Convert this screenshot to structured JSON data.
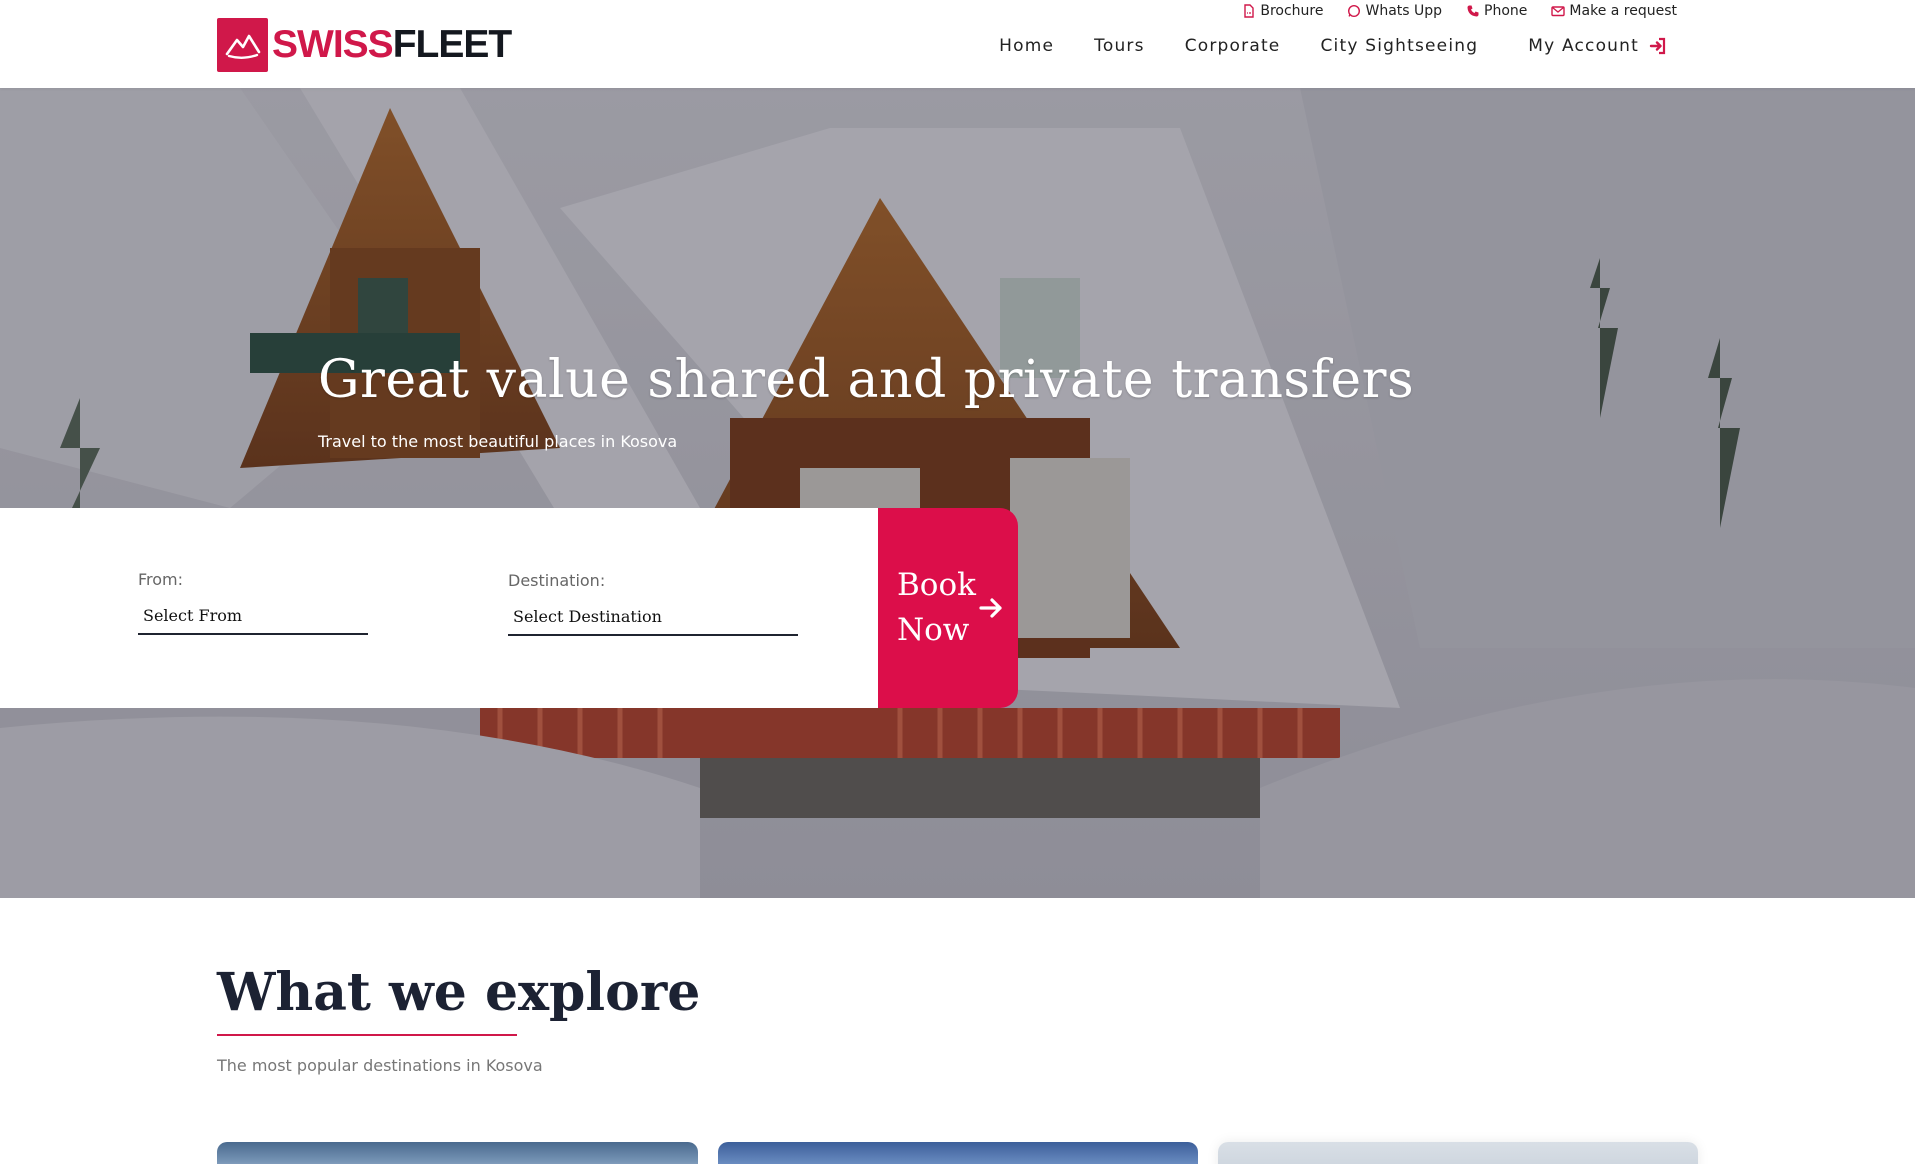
{
  "brand": {
    "part1": "SWISS",
    "part2": "FLEET",
    "accent_color": "#d0184a"
  },
  "topbar": {
    "items": [
      {
        "label": "Brochure",
        "icon": "pdf-file-icon"
      },
      {
        "label": "Whats Upp",
        "icon": "whatsapp-icon"
      },
      {
        "label": "Phone",
        "icon": "phone-icon"
      },
      {
        "label": "Make a request",
        "icon": "envelope-icon"
      }
    ]
  },
  "nav": {
    "items": [
      "Home",
      "Tours",
      "Corporate",
      "City Sightseeing"
    ],
    "account": {
      "label": "My Account",
      "icon": "sign-in-icon"
    }
  },
  "hero": {
    "title": "Great value shared and private transfers",
    "subtitle": "Travel to the most beautiful places in Kosova"
  },
  "search": {
    "from": {
      "label": "From:",
      "value": "Select From"
    },
    "destination": {
      "label": "Destination:",
      "value": "Select Destination"
    },
    "button": {
      "line1": "Book",
      "line2": "Now",
      "icon": "arrow-right-icon"
    }
  },
  "explore": {
    "title": "What we explore",
    "subtitle": "The most popular destinations in Kosova"
  }
}
